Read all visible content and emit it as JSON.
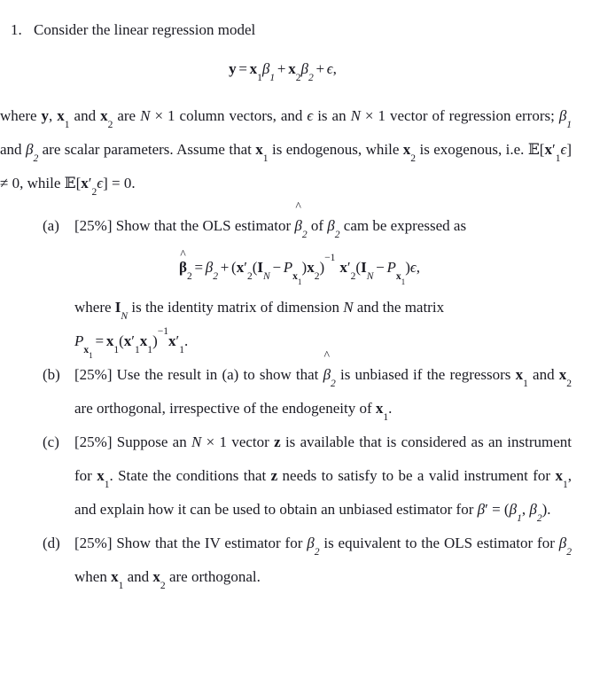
{
  "document": {
    "type": "exam-question",
    "problem_number": "1.",
    "stem": "Consider the linear regression model",
    "model_equation": "y = x₁β₁ + x₂β₂ + ϵ,",
    "intro_paragraph": "where y, x₁ and x₂ are N × 1 column vectors, and ϵ is an N × 1 vector of regression errors; β₁ and β₂ are scalar parameters. Assume that x₁ is endogenous, while x₂ is exogenous, i.e. 𝔼[x′₁ϵ] ≠ 0, while 𝔼[x′₂ϵ] = 0.",
    "subparts": [
      {
        "marker": "(a)",
        "weight": "[25%]",
        "text": "Show that the OLS estimator β̂₂ of β₂ cam be expressed as",
        "equation": "β̂₂ = β₂ + (x′₂(I_N − P_x₁)x₂)⁻¹ x′₂(I_N − P_x₁)ϵ,",
        "where_text": "where I_N is the identity matrix of dimension N and the matrix",
        "where_equation": "P_x₁ = x₁(x′₁x₁)⁻¹x′₁."
      },
      {
        "marker": "(b)",
        "weight": "[25%]",
        "text": "Use the result in (a) to show that β̂₂ is unbiased if the regressors x₁ and x₂ are orthogonal, irrespective of the endogeneity of x₁."
      },
      {
        "marker": "(c)",
        "weight": "[25%]",
        "text": "Suppose an N × 1 vector z is available that is considered as an instrument for x₁. State the conditions that z needs to satisfy to be a valid instrument for x₁, and explain how it can be used to obtain an unbiased estimator for β′ = (β₁, β₂)."
      },
      {
        "marker": "(d)",
        "weight": "[25%]",
        "text": "Show that the IV estimator for β₂ is equivalent to the OLS estimator for β₂ when x₁ and x₂ are orthogonal."
      }
    ]
  },
  "labels": {
    "weight_a": "[25%]",
    "weight_b": "[25%]",
    "weight_c": "[25%]",
    "weight_d": "[25%]",
    "marker_1": "1.",
    "marker_a": "(a)",
    "marker_b": "(b)",
    "marker_c": "(c)",
    "marker_d": "(d)"
  },
  "colors": {
    "page_background": "#ffffff",
    "text": "#1a1a22"
  }
}
